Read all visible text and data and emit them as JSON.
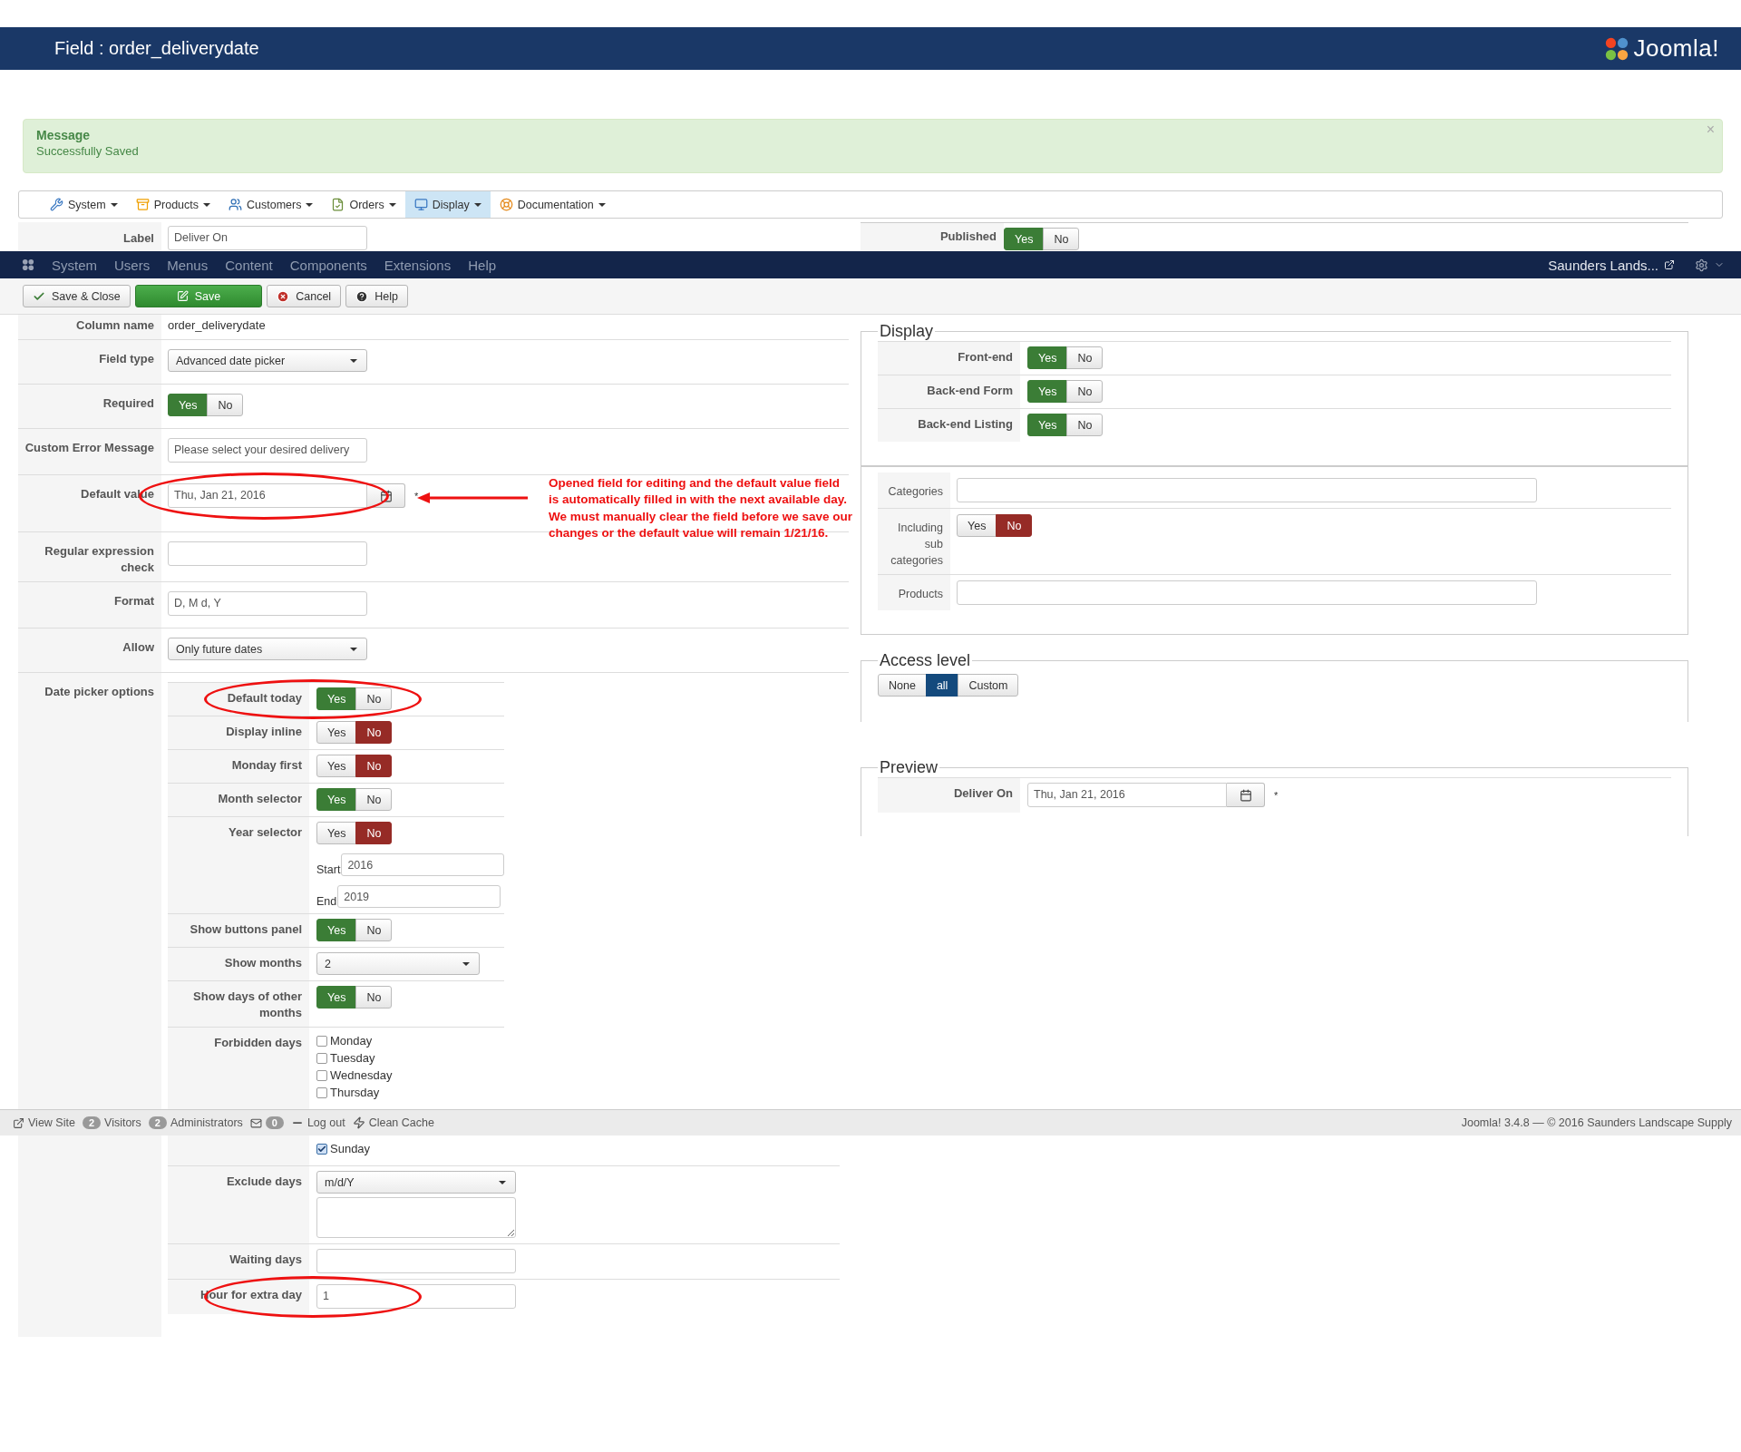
{
  "header": {
    "title": "Field : order_deliverydate",
    "logo": "Joomla!"
  },
  "message": {
    "heading": "Message",
    "text": "Successfully Saved",
    "close": "×"
  },
  "component_menu": [
    {
      "label": "System",
      "selected": false
    },
    {
      "label": "Products",
      "selected": false
    },
    {
      "label": "Customers",
      "selected": false
    },
    {
      "label": "Orders",
      "selected": false
    },
    {
      "label": "Display",
      "selected": true
    },
    {
      "label": "Documentation",
      "selected": false
    }
  ],
  "peek_row": {
    "label": "Label",
    "value": "Deliver On",
    "right_label": "Published",
    "options": [
      {
        "label": "Yes",
        "kind": "yes",
        "selected": true
      },
      {
        "label": "No",
        "kind": "no",
        "selected": false
      }
    ]
  },
  "navbar": {
    "items": [
      "System",
      "Users",
      "Menus",
      "Content",
      "Components",
      "Extensions",
      "Help"
    ],
    "site": "Saunders Lands..."
  },
  "toolbar": [
    {
      "label": "Save & Close",
      "kind": "default"
    },
    {
      "label": "Save",
      "kind": "primary"
    },
    {
      "label": "Cancel",
      "kind": "default"
    },
    {
      "label": "Help",
      "kind": "default"
    }
  ],
  "form": {
    "rows": [
      {
        "kind": "static",
        "label": "Column name",
        "value": "order_deliverydate",
        "circled": false
      },
      {
        "kind": "select",
        "label": "Field type",
        "value": "Advanced date picker",
        "circled": false
      },
      {
        "kind": "toggle",
        "label": "Required",
        "options": [
          {
            "label": "Yes",
            "kind": "yes",
            "selected": true
          },
          {
            "label": "No",
            "kind": "no",
            "selected": false
          }
        ],
        "circled": false
      },
      {
        "kind": "input",
        "label": "Custom Error Message",
        "value": "Please select your desired delivery",
        "circled": false
      },
      {
        "kind": "date",
        "label": "Default value",
        "value": "Thu, Jan 21, 2016",
        "mark": "*",
        "circled": true,
        "note": {
          "lines": [
            "Opened field for editing and the default value field",
            "is automatically filled in with the next available day.",
            "We must manually clear the field before we save our",
            "changes or the default value will remain 1/21/16."
          ]
        }
      },
      {
        "kind": "input",
        "label": "Regular expression check",
        "circled": false
      },
      {
        "kind": "input",
        "label": "Format",
        "value": "D, M d, Y",
        "circled": false
      },
      {
        "kind": "select",
        "label": "Allow",
        "value": "Only future dates",
        "circled": false
      },
      {
        "kind": "group",
        "label": "Date picker options",
        "circled": false,
        "rows": [
          {
            "kind": "toggle",
            "label": "Default today",
            "options": [
              {
                "label": "Yes",
                "kind": "yes",
                "selected": true
              },
              {
                "label": "No",
                "kind": "no",
                "selected": false
              }
            ],
            "circled": true
          },
          {
            "kind": "toggle",
            "label": "Display inline",
            "options": [
              {
                "label": "Yes",
                "kind": "yes",
                "selected": false
              },
              {
                "label": "No",
                "kind": "no",
                "selected": true
              }
            ],
            "circled": false
          },
          {
            "kind": "toggle",
            "label": "Monday first",
            "options": [
              {
                "label": "Yes",
                "kind": "yes",
                "selected": false
              },
              {
                "label": "No",
                "kind": "no",
                "selected": true
              }
            ],
            "circled": false
          },
          {
            "kind": "toggle",
            "label": "Month selector",
            "options": [
              {
                "label": "Yes",
                "kind": "yes",
                "selected": true
              },
              {
                "label": "No",
                "kind": "no",
                "selected": false
              }
            ],
            "circled": false
          },
          {
            "kind": "toggle",
            "label": "Year selector",
            "options": [
              {
                "label": "Yes",
                "kind": "yes",
                "selected": false
              },
              {
                "label": "No",
                "kind": "no",
                "selected": true
              }
            ],
            "range": [
              {
                "label": "Start",
                "value": "2016"
              },
              {
                "label": "End",
                "value": "2019"
              }
            ],
            "circled": false
          },
          {
            "kind": "toggle",
            "label": "Show buttons panel",
            "options": [
              {
                "label": "Yes",
                "kind": "yes",
                "selected": true
              },
              {
                "label": "No",
                "kind": "no",
                "selected": false
              }
            ],
            "circled": false
          },
          {
            "kind": "select",
            "label": "Show months",
            "value": "2",
            "circled": false
          },
          {
            "kind": "toggle",
            "label": "Show days of other months",
            "options": [
              {
                "label": "Yes",
                "kind": "yes",
                "selected": true
              },
              {
                "label": "No",
                "kind": "no",
                "selected": false
              }
            ],
            "circled": false
          },
          {
            "kind": "checklist",
            "label": "Forbidden days",
            "items": [
              {
                "label": "Monday",
                "checked": false
              },
              {
                "label": "Tuesday",
                "checked": false
              },
              {
                "label": "Wednesday",
                "checked": false
              },
              {
                "label": "Thursday",
                "checked": false
              }
            ],
            "circled": false
          }
        ]
      }
    ]
  },
  "side_panels": [
    {
      "kind": "rows",
      "legend": "Display",
      "rows": [
        {
          "kind": "toggle",
          "label": "Front-end",
          "options": [
            {
              "label": "Yes",
              "kind": "yes",
              "selected": true
            },
            {
              "label": "No",
              "kind": "no",
              "selected": false
            }
          ]
        },
        {
          "kind": "toggle",
          "label": "Back-end Form",
          "options": [
            {
              "label": "Yes",
              "kind": "yes",
              "selected": true
            },
            {
              "label": "No",
              "kind": "no",
              "selected": false
            }
          ]
        },
        {
          "kind": "toggle",
          "label": "Back-end Listing",
          "options": [
            {
              "label": "Yes",
              "kind": "yes",
              "selected": true
            },
            {
              "label": "No",
              "kind": "no",
              "selected": false
            }
          ]
        }
      ]
    },
    {
      "kind": "plain_rows",
      "rows": [
        {
          "kind": "input",
          "label": "Categories"
        },
        {
          "kind": "toggle",
          "label": "Including sub categories",
          "options": [
            {
              "label": "Yes",
              "kind": "yes",
              "selected": false
            },
            {
              "label": "No",
              "kind": "no",
              "selected": true
            }
          ]
        },
        {
          "kind": "input",
          "label": "Products"
        }
      ]
    },
    {
      "kind": "buttons",
      "legend": "Access level",
      "options": [
        {
          "label": "None",
          "kind": "neutral",
          "selected": false
        },
        {
          "label": "all",
          "kind": "neutral",
          "selected": true
        },
        {
          "label": "Custom",
          "kind": "neutral",
          "selected": false
        }
      ]
    },
    {
      "kind": "rows",
      "legend": "Preview",
      "rows": [
        {
          "kind": "date",
          "label": "Deliver On",
          "value": "Thu, Jan 21, 2016",
          "mark": "*"
        }
      ]
    }
  ],
  "status_bar": {
    "items": [
      {
        "label": "View Site"
      },
      {
        "count": "2",
        "label": "Visitors"
      },
      {
        "count": "2",
        "label": "Administrators"
      },
      {
        "count": "0"
      },
      {
        "label": "Log out"
      },
      {
        "label": "Clean Cache"
      }
    ],
    "version": "Joomla! 3.4.8 — © 2016 Saunders Landscape Supply"
  },
  "form_continued": {
    "rows": [
      {
        "kind": "checklist",
        "items": [
          {
            "label": "Sunday",
            "checked": true
          }
        ],
        "circled": false
      },
      {
        "kind": "select_textarea",
        "label": "Exclude days",
        "value": "m/d/Y",
        "circled": false
      },
      {
        "kind": "input",
        "label": "Waiting days",
        "circled": false
      },
      {
        "kind": "input",
        "label": "Hour for extra day",
        "value": "1",
        "circled": true
      }
    ]
  }
}
